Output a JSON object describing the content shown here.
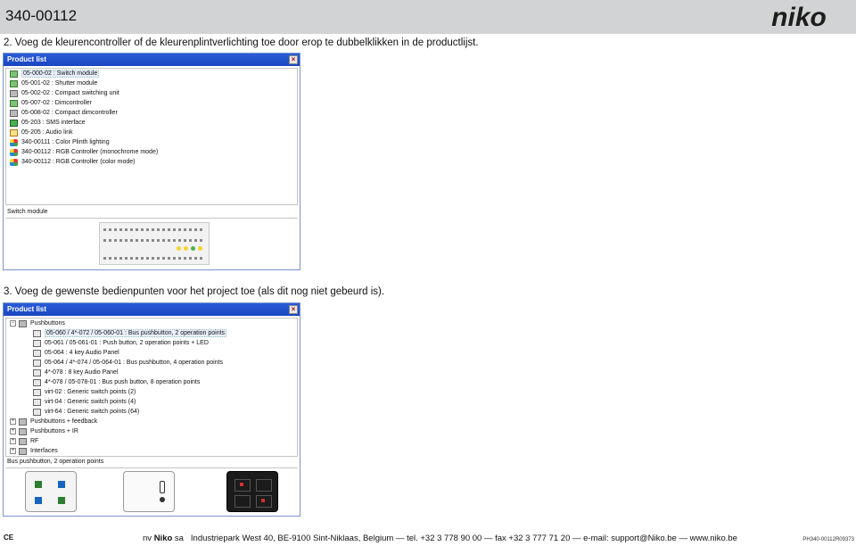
{
  "header": {
    "doc_code": "340-00112",
    "logo": "niko"
  },
  "steps": {
    "step2": "2. Voeg de kleurencontroller of de kleurenplintverlichting toe door erop te dubbelklikken in de productlijst.",
    "step3": "3. Voeg de gewenste bedienpunten voor het project toe (als dit nog niet gebeurd is)."
  },
  "window1": {
    "title": "Product list",
    "close_glyph": "×",
    "items": [
      {
        "label": "05-000-02 : Switch module",
        "icon": "switch-module-icon",
        "selected": true
      },
      {
        "label": "05-001-02 : Shutter module",
        "icon": "shutter-module-icon"
      },
      {
        "label": "05-002-02 : Compact switching unit",
        "icon": "compact-switch-icon"
      },
      {
        "label": "05-007-02 : Dimcontroller",
        "icon": "dimcontroller-icon"
      },
      {
        "label": "05-008-02 : Compact dimcontroller",
        "icon": "compact-dimcontroller-icon"
      },
      {
        "label": "05-203 : SMS interface",
        "icon": "sms-interface-icon"
      },
      {
        "label": "05-205 : Audio link",
        "icon": "audio-link-icon"
      },
      {
        "label": "340-00111 : Color Plinth lighting",
        "icon": "rgb-icon"
      },
      {
        "label": "340-00112 : RGB Controller (monochrome mode)",
        "icon": "rgb-icon"
      },
      {
        "label": "340-00112 : RGB Controller (color mode)",
        "icon": "rgb-icon"
      }
    ],
    "info_label": "Switch module"
  },
  "window2": {
    "title": "Product list",
    "close_glyph": "×",
    "groups": [
      {
        "label": "Pushbuttons",
        "expander": "−",
        "children": [
          {
            "label": "05-060 / 4*-072 / 05-060-01 : Bus pushbutton, 2 operation points",
            "selected": true
          },
          {
            "label": "05-061 / 05-061-01 : Push button, 2 operation points + LED"
          },
          {
            "label": "05-064 : 4 key Audio Panel"
          },
          {
            "label": "05-064 / 4*-074 / 05-064-01 : Bus pushbutton, 4 operation points"
          },
          {
            "label": "4*-078 : 8 key Audio Panel"
          },
          {
            "label": "4*-078 / 05-078-01 : Bus push button, 8 operation points"
          },
          {
            "label": "virt-02 : Generic switch points (2)"
          },
          {
            "label": "virt-04 : Generic switch points (4)"
          },
          {
            "label": "virt-64 : Generic switch points (64)"
          }
        ]
      },
      {
        "label": "Pushbuttons + feedback",
        "expander": "+"
      },
      {
        "label": "Pushbuttons + IR",
        "expander": "+"
      },
      {
        "label": "RF",
        "expander": "+"
      },
      {
        "label": "Interfaces",
        "expander": "+"
      }
    ],
    "info_label": "Bus pushbutton, 2 operation points"
  },
  "footer": {
    "mark": "CE",
    "company_prefix": "nv",
    "company_name": "Niko",
    "company_suffix": "sa",
    "address": "Industriepark West 40, BE-9100 Sint-Niklaas, Belgium — tel. +32 3 778 90 00 — fax +32 3 777 71 20 — e-mail: support@Niko.be — www.niko.be",
    "doc_ref": "PH340-00112R09373"
  },
  "colors": {
    "titlebar": "#2a5dd8",
    "header_bar": "#d2d3d4",
    "logo": "#1d1d1b"
  }
}
